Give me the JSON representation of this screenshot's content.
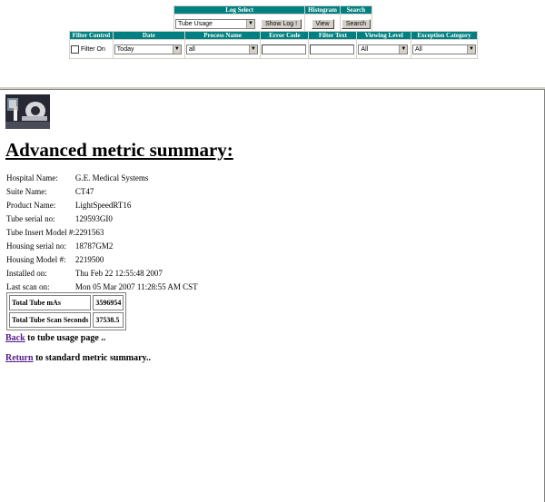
{
  "controls": {
    "headers": {
      "log_select": "Log Select",
      "histogram": "Histogram",
      "search": "Search",
      "filter_control": "Filter Control",
      "date": "Date",
      "process_name": "Process Name",
      "error_code": "Error Code",
      "filter_text": "Filter Text",
      "viewing_level": "Viewing Level",
      "exception_category": "Exception Category"
    },
    "log_select_value": "Tube Usage",
    "show_log_label": "Show Log !",
    "view_label": "View",
    "search_label": "Search",
    "filter_on_label": "Filter On",
    "date_value": "Today",
    "process_value": "all",
    "error_code_value": "",
    "filter_text_value": "",
    "viewing_level_value": "All",
    "exception_category_value": "All"
  },
  "page": {
    "title": "Advanced metric summary:",
    "info": [
      {
        "label": "Hospital Name:",
        "value": "G.E. Medical Systems"
      },
      {
        "label": "Suite Name:",
        "value": "CT47"
      },
      {
        "label": "Product Name:",
        "value": "LightSpeedRT16"
      },
      {
        "label": "Tube serial no:",
        "value": "129593GI0"
      },
      {
        "label": "Tube Insert Model #:",
        "value": "2291563"
      },
      {
        "label": "Housing serial no:",
        "value": "18787GM2"
      },
      {
        "label": "Housing Model #:",
        "value": "2219500"
      },
      {
        "label": "Installed on:",
        "value": "Thu Feb 22 12:55:48 2007"
      },
      {
        "label": "Last scan on:",
        "value": "Mon 05 Mar 2007 11:28:55 AM CST"
      }
    ],
    "stats": [
      {
        "label": "Total Tube mAs",
        "value": "3596954"
      },
      {
        "label": "Total Tube Scan Seconds",
        "value": "37538.5"
      }
    ],
    "back_link": "Back",
    "back_text": " to tube usage page ..",
    "return_link": "Return",
    "return_text": " to standard metric summary.."
  }
}
